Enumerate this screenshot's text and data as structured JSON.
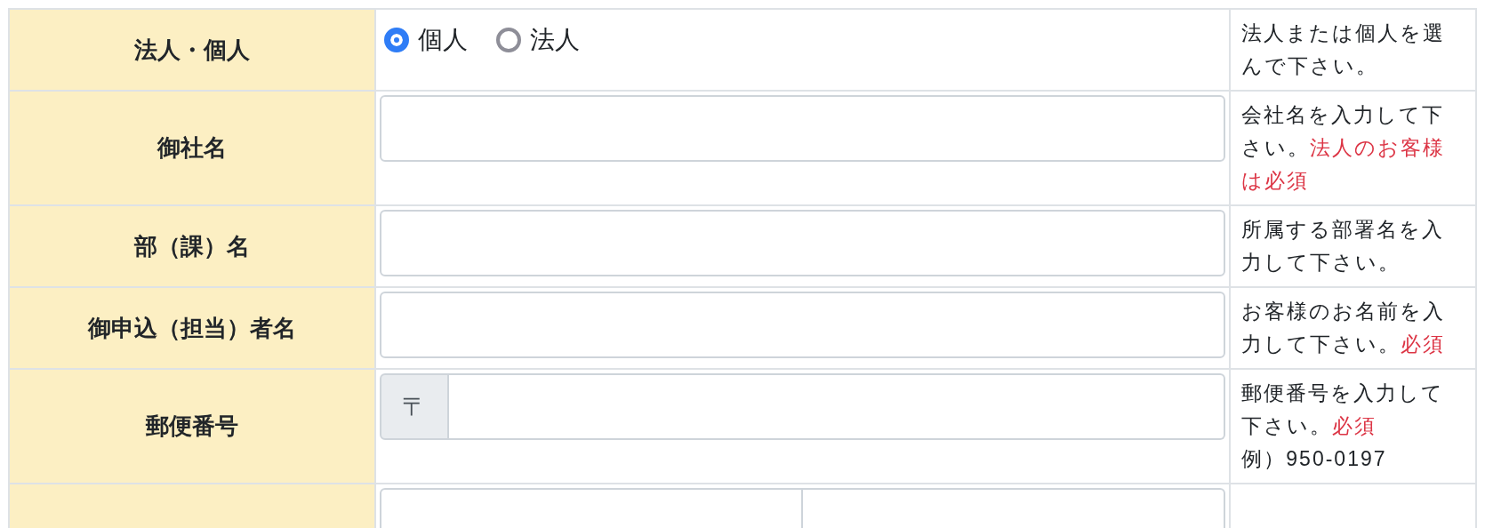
{
  "rows": [
    {
      "kind": "radio",
      "label": "法人・個人",
      "options": [
        {
          "label": "個人",
          "selected": true
        },
        {
          "label": "法人",
          "selected": false
        }
      ],
      "note": [
        {
          "kind": "plain",
          "text": "法人または個人を選んで下さい。"
        }
      ]
    },
    {
      "kind": "text",
      "label": "御社名",
      "note": [
        {
          "kind": "plain",
          "text": "会社名を入力して下さい。"
        },
        {
          "kind": "required",
          "text": "法人のお客様は必須"
        }
      ]
    },
    {
      "kind": "text",
      "label": "部（課）名",
      "note": [
        {
          "kind": "plain",
          "text": "所属する部署名を入力して下さい。"
        }
      ]
    },
    {
      "kind": "text",
      "label": "御申込（担当）者名",
      "note": [
        {
          "kind": "plain",
          "text": "お客様のお名前を入力して下さい。"
        },
        {
          "kind": "required",
          "text": "必須"
        }
      ]
    },
    {
      "kind": "zip",
      "label": "郵便番号",
      "prefix": "〒",
      "note": [
        {
          "kind": "plain",
          "text": "郵便番号を入力して下さい。"
        },
        {
          "kind": "required",
          "text": "必須"
        },
        {
          "kind": "example",
          "text": "例）950-0197"
        }
      ]
    },
    {
      "kind": "pair"
    }
  ]
}
